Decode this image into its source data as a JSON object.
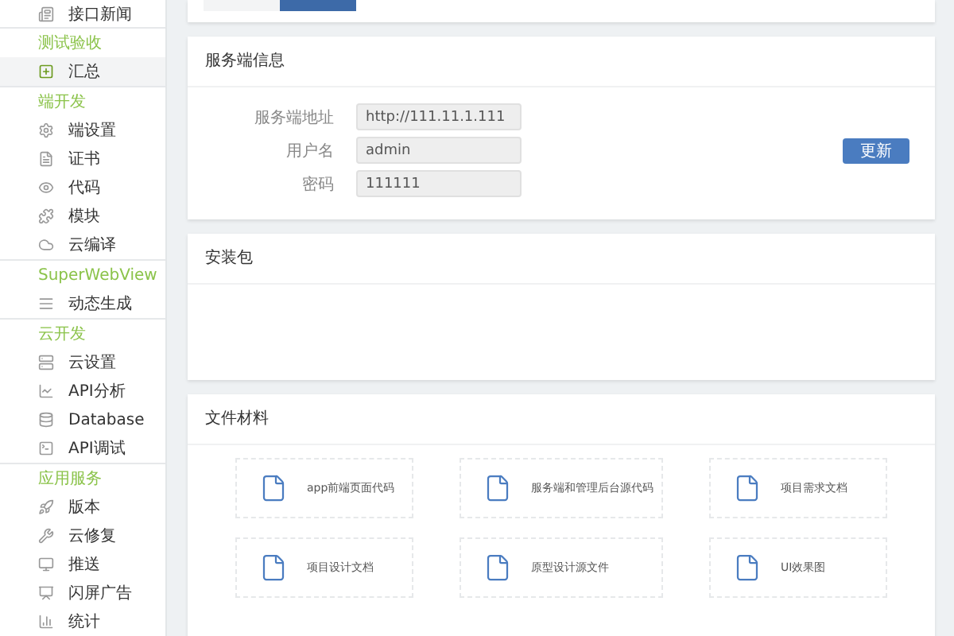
{
  "sidebar": {
    "top_item": {
      "label": "接口新闻"
    },
    "groups": [
      {
        "title": "测试验收",
        "items": [
          {
            "label": "汇总",
            "selected": true
          }
        ]
      },
      {
        "title": "端开发",
        "items": [
          {
            "label": "端设置",
            "selected": false
          },
          {
            "label": "证书",
            "selected": false
          },
          {
            "label": "代码",
            "selected": false
          },
          {
            "label": "模块",
            "selected": false
          },
          {
            "label": "云编译",
            "selected": false
          }
        ]
      },
      {
        "title": "SuperWebView",
        "items": [
          {
            "label": "动态生成",
            "selected": false
          }
        ]
      },
      {
        "title": "云开发",
        "items": [
          {
            "label": "云设置",
            "selected": false
          },
          {
            "label": "API分析",
            "selected": false
          },
          {
            "label": "Database",
            "selected": false
          },
          {
            "label": "API调试",
            "selected": false
          }
        ]
      },
      {
        "title": "应用服务",
        "items": [
          {
            "label": "版本",
            "selected": false
          },
          {
            "label": "云修复",
            "selected": false
          },
          {
            "label": "推送",
            "selected": false
          },
          {
            "label": "闪屏广告",
            "selected": false
          },
          {
            "label": "统计",
            "selected": false
          }
        ]
      }
    ]
  },
  "top_tabs": [
    {
      "selected": false
    },
    {
      "selected": true
    }
  ],
  "server_info": {
    "title": "服务端信息",
    "fields": [
      {
        "label": "服务端地址",
        "value": "http://111.11.1.111"
      },
      {
        "label": "用户名",
        "value": "admin"
      },
      {
        "label": "密码",
        "value": "111111"
      }
    ],
    "button": "更新"
  },
  "package": {
    "title": "安装包"
  },
  "files": {
    "title": "文件材料",
    "items": [
      {
        "name": "app前端页面代码"
      },
      {
        "name": "服务端和管理后台源代码"
      },
      {
        "name": "项目需求文档"
      },
      {
        "name": "项目设计文档"
      },
      {
        "name": "原型设计源文件"
      },
      {
        "name": "UI效果图"
      }
    ]
  }
}
